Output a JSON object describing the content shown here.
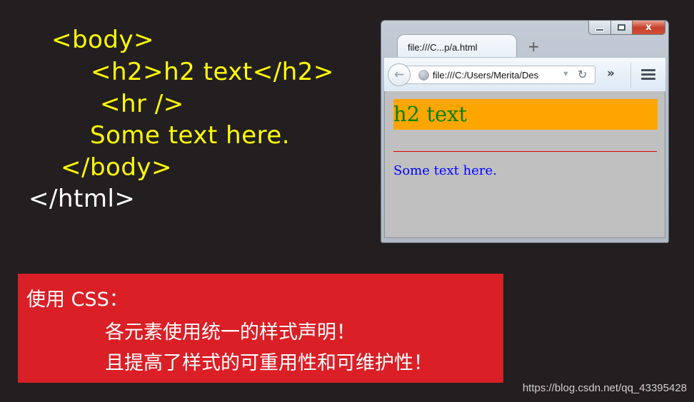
{
  "code": {
    "lines": [
      "<body>",
      "<h2>h2 text</h2>",
      "<hr />",
      "Some text here.",
      "</body>",
      "</html>"
    ]
  },
  "browser": {
    "tab_title": "file:///C...p/a.html",
    "new_tab_label": "+",
    "url": "file:///C:/Users/Merita/Desktop/a.html",
    "url_visible": "file:///C:/Users/Merita/Des",
    "window_controls": {
      "minimize": "minimize",
      "maximize": "maximize",
      "close": "x"
    },
    "overflow_label": "»",
    "page": {
      "h2_text": "h2 text",
      "paragraph_text": "Some text here.",
      "background_color": "#c0c0c0",
      "h2_background": "#ffa500",
      "h2_color": "#008000",
      "hr_color": "#e00000",
      "paragraph_color": "#0000ff"
    }
  },
  "note": {
    "title": "使用 CSS：",
    "line1": "各元素使用统一的样式声明！",
    "line2": "且提高了样式的可重用性和可维护性！",
    "background": "#da1f26"
  },
  "watermark": "https://blog.csdn.net/qq_43395428"
}
